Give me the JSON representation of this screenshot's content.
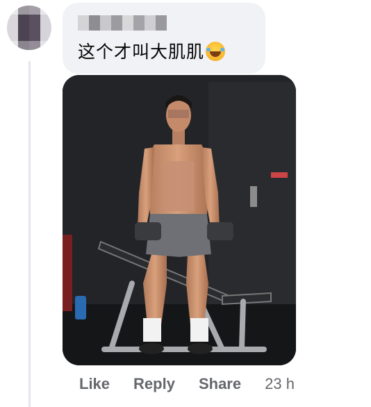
{
  "comment": {
    "author_name": "",
    "text": "这个才叫大肌肌",
    "emoji": "laughing-tears-emoji"
  },
  "actions": {
    "like_label": "Like",
    "reply_label": "Reply",
    "share_label": "Share",
    "timestamp": "23 h"
  },
  "colors": {
    "bubble": "#f0f2f5",
    "action_text": "#65676b",
    "thread_line": "#e4e6eb"
  }
}
